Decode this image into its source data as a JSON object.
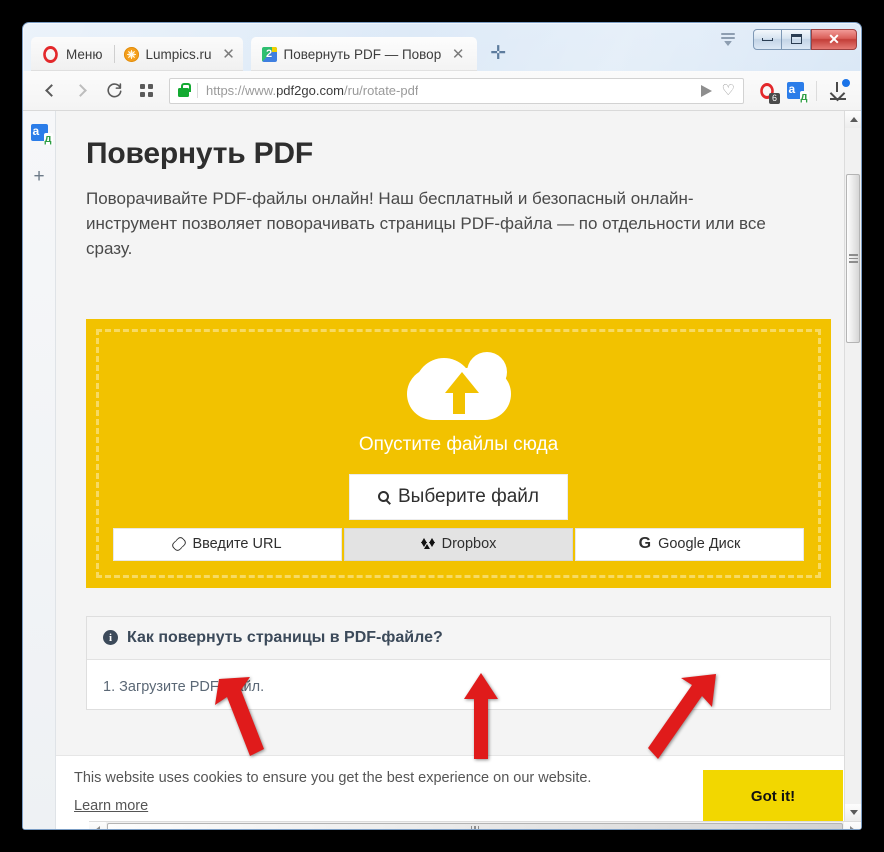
{
  "browser": {
    "menu_label": "Меню",
    "tabs": [
      {
        "title": "Lumpics.ru",
        "favicon": "orange-circle-icon",
        "active": false
      },
      {
        "title": "Повернуть PDF — Повор",
        "favicon": "pdf2go-icon",
        "active": true
      }
    ],
    "new_tab_label": "+",
    "window_controls": {
      "minimize": "–",
      "maximize": "❐",
      "close": "✕"
    },
    "toolbar": {
      "back_icon": "chevron-left-icon",
      "forward_icon": "chevron-right-icon",
      "reload_icon": "reload-icon",
      "speeddial_icon": "grid-icon",
      "url_scheme": "https://www.",
      "url_host": "pdf2go.com",
      "url_path": "/ru/rotate-pdf",
      "lock_icon": "padlock-icon",
      "send_icon": "send-arrow-icon",
      "heart_icon": "heart-icon",
      "adblock_badge": "6",
      "download_icon": "download-icon"
    },
    "sidebar": {
      "translate_icon": "translate-extension-icon",
      "add_label": "+"
    }
  },
  "page": {
    "title": "Повернуть PDF",
    "description": "Поворачивайте PDF-файлы онлайн! Наш бесплатный и безопасный онлайн-инструмент позволяет поворачивать страницы PDF-файла — по отдельности или все сразу.",
    "dropzone": {
      "cloud_icon": "cloud-upload-icon",
      "drop_text": "Опустите файлы сюда",
      "choose_file_label": "Выберите файл",
      "choose_file_icon": "magnifier-icon",
      "sources": [
        {
          "label": "Введите URL",
          "icon": "link-icon",
          "state": "normal"
        },
        {
          "label": "Dropbox",
          "icon": "dropbox-icon",
          "state": "hover"
        },
        {
          "label": "Google Диск",
          "icon": "google-g-icon",
          "state": "normal"
        }
      ],
      "bg_color": "#f2c200",
      "border_color": "#f7da62"
    },
    "howto": {
      "icon": "info-icon",
      "heading": "Как повернуть страницы в PDF-файле?",
      "steps": [
        "1. Загрузите PDF-файл."
      ]
    },
    "cookie": {
      "text": "This website uses cookies to ensure you get the best experience on our website.",
      "link": "Learn more",
      "button": "Got it!",
      "button_color": "#f2d700"
    }
  },
  "annotations": {
    "arrow_color": "#e01b1b",
    "arrows": [
      {
        "name": "arrow-to-url-button",
        "direction": "up-left"
      },
      {
        "name": "arrow-to-dropbox-button",
        "direction": "up"
      },
      {
        "name": "arrow-to-google-drive-button",
        "direction": "up-right"
      }
    ]
  }
}
